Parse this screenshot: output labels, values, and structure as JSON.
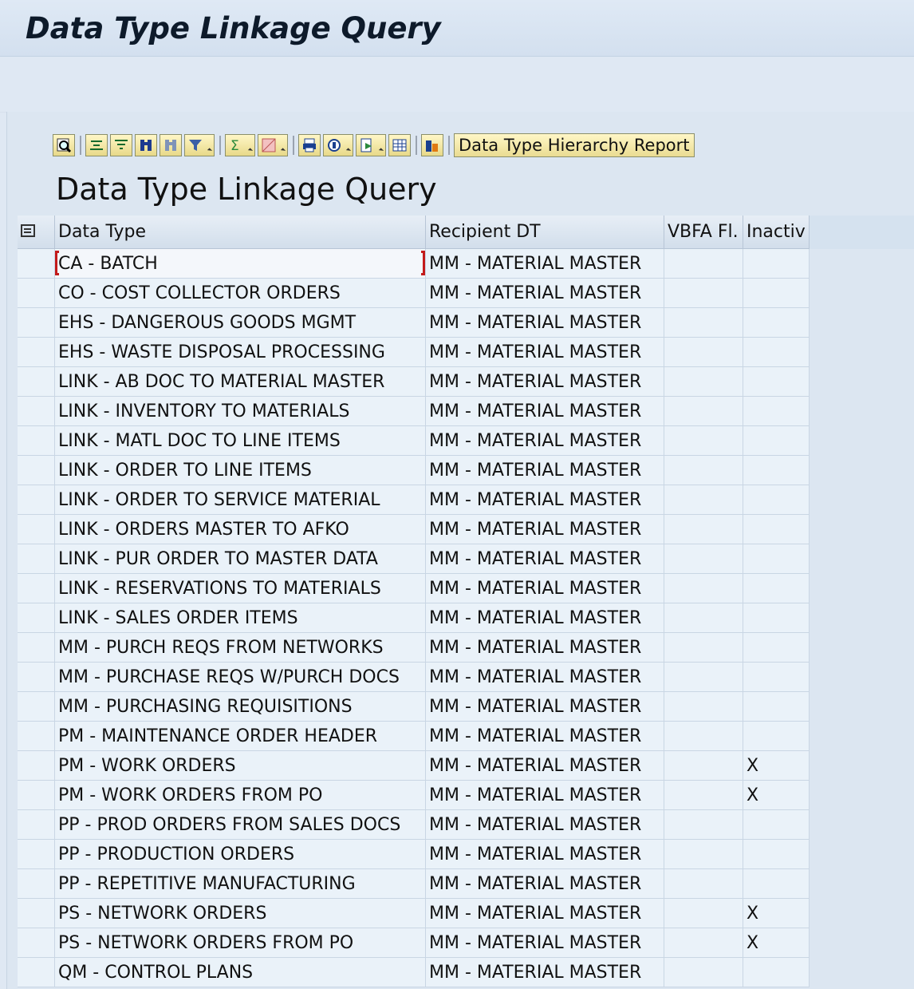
{
  "window": {
    "title": "Data Type Linkage Query"
  },
  "toolbar": {
    "icons": [
      "details-icon",
      "sort-ascending-icon",
      "sort-descending-icon",
      "find-icon",
      "find-next-icon",
      "filter-icon",
      "sum-icon",
      "subtotals-icon",
      "print-preview-icon",
      "export-icon",
      "send-icon",
      "layout-icon",
      "abc-analysis-icon"
    ],
    "report_button": "Data Type Hierarchy Report"
  },
  "grid": {
    "title": "Data Type Linkage Query",
    "columns": [
      "Data Type",
      "Recipient DT",
      "VBFA Fl.",
      "Inactiv"
    ],
    "rows": [
      [
        "CA - BATCH",
        "MM - MATERIAL MASTER",
        "",
        ""
      ],
      [
        "CO - COST COLLECTOR ORDERS",
        "MM - MATERIAL MASTER",
        "",
        ""
      ],
      [
        "EHS - DANGEROUS GOODS MGMT",
        "MM - MATERIAL MASTER",
        "",
        ""
      ],
      [
        "EHS - WASTE DISPOSAL PROCESSING",
        "MM - MATERIAL MASTER",
        "",
        ""
      ],
      [
        "LINK - AB DOC TO MATERIAL MASTER",
        "MM - MATERIAL MASTER",
        "",
        ""
      ],
      [
        "LINK - INVENTORY TO MATERIALS",
        "MM - MATERIAL MASTER",
        "",
        ""
      ],
      [
        "LINK - MATL DOC TO LINE ITEMS",
        "MM - MATERIAL MASTER",
        "",
        ""
      ],
      [
        "LINK - ORDER TO LINE ITEMS",
        "MM - MATERIAL MASTER",
        "",
        ""
      ],
      [
        "LINK - ORDER TO SERVICE MATERIAL",
        "MM - MATERIAL MASTER",
        "",
        ""
      ],
      [
        "LINK - ORDERS MASTER TO AFKO",
        "MM - MATERIAL MASTER",
        "",
        ""
      ],
      [
        "LINK - PUR ORDER TO MASTER DATA",
        "MM - MATERIAL MASTER",
        "",
        ""
      ],
      [
        "LINK - RESERVATIONS TO MATERIALS",
        "MM - MATERIAL MASTER",
        "",
        ""
      ],
      [
        "LINK - SALES ORDER ITEMS",
        "MM - MATERIAL MASTER",
        "",
        ""
      ],
      [
        "MM - PURCH REQS FROM NETWORKS",
        "MM - MATERIAL MASTER",
        "",
        ""
      ],
      [
        "MM - PURCHASE REQS W/PURCH DOCS",
        "MM - MATERIAL MASTER",
        "",
        ""
      ],
      [
        "MM - PURCHASING REQUISITIONS",
        "MM - MATERIAL MASTER",
        "",
        ""
      ],
      [
        "PM - MAINTENANCE ORDER HEADER",
        "MM - MATERIAL MASTER",
        "",
        ""
      ],
      [
        "PM - WORK ORDERS",
        "MM - MATERIAL MASTER",
        "",
        "X"
      ],
      [
        "PM - WORK ORDERS FROM PO",
        "MM - MATERIAL MASTER",
        "",
        "X"
      ],
      [
        "PP - PROD ORDERS FROM SALES DOCS",
        "MM - MATERIAL MASTER",
        "",
        ""
      ],
      [
        "PP - PRODUCTION ORDERS",
        "MM - MATERIAL MASTER",
        "",
        ""
      ],
      [
        "PP - REPETITIVE MANUFACTURING",
        "MM - MATERIAL MASTER",
        "",
        ""
      ],
      [
        "PS - NETWORK ORDERS",
        "MM - MATERIAL MASTER",
        "",
        "X"
      ],
      [
        "PS - NETWORK ORDERS FROM PO",
        "MM - MATERIAL MASTER",
        "",
        "X"
      ],
      [
        "QM - CONTROL PLANS",
        "MM - MATERIAL MASTER",
        "",
        ""
      ]
    ]
  }
}
